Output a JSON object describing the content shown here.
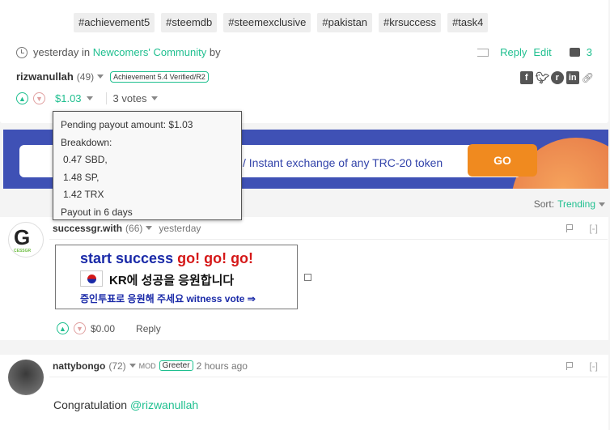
{
  "tags": [
    "#achievement5",
    "#steemdb",
    "#steemexclusive",
    "#pakistan",
    "#krsuccess",
    "#task4"
  ],
  "post": {
    "time": "yesterday",
    "in_text": "in",
    "community": "Newcomers' Community",
    "by_text": "by",
    "reply_label": "Reply",
    "edit_label": "Edit",
    "comment_count": "3",
    "author": "rizwanullah",
    "reputation": "(49)",
    "badge": "Achievement 5.4 Verified/R2",
    "payout": "$1.03",
    "votes": "3 votes"
  },
  "tooltip": {
    "pending": "Pending payout amount: $1.03",
    "breakdown": "Breakdown:",
    "sbd": "0.47 SBD,",
    "sp": "1.48 SP,",
    "trx": "1.42 TRX",
    "payout_in": "Payout in 6 days"
  },
  "banner": {
    "text": "/ Instant exchange of any TRC-20 token",
    "go_label": "GO"
  },
  "sort": {
    "label": "Sort:",
    "value": "Trending"
  },
  "comments": [
    {
      "author": "successgr.with",
      "reputation": "(66)",
      "time": "yesterday",
      "collapse": "[-]",
      "ad_line1_a": "start success",
      "ad_line1_b": "go! go! go!",
      "ad_line2": "KR에 성공을 응원합니다",
      "ad_line3": "증인투표로 응원해 주세요 witness vote ⇒",
      "payout": "$0.00",
      "reply_label": "Reply"
    },
    {
      "author": "nattybongo",
      "reputation": "(72)",
      "mod": "MOD",
      "greeter": "Greeter",
      "time": "2 hours ago",
      "collapse": "[-]",
      "body_text": "Congratulation ",
      "mention": "@rizwanullah"
    }
  ],
  "colors": {
    "accent": "#1fbf8f",
    "banner_bg": "#3f51b5",
    "go_button": "#f08a1f"
  }
}
